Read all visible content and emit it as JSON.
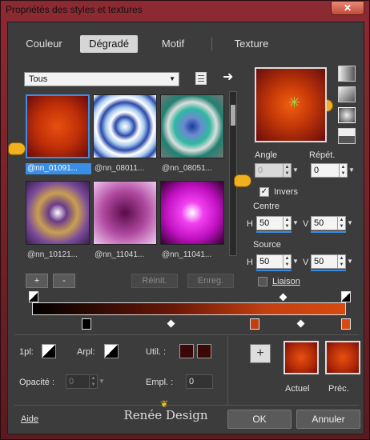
{
  "window": {
    "title": "Propriétés des styles et textures",
    "close_glyph": "✕"
  },
  "tabs": [
    {
      "label": "Couleur",
      "active": false
    },
    {
      "label": "Dégradé",
      "active": true
    },
    {
      "label": "Motif",
      "active": false
    },
    {
      "label": "Texture",
      "active": false
    }
  ],
  "preset_select": {
    "value": "Tous"
  },
  "swatches": [
    {
      "label": "@nn_01091...",
      "selected": true
    },
    {
      "label": "@nn_08011...",
      "selected": false
    },
    {
      "label": "@nn_08051...",
      "selected": false
    },
    {
      "label": "@nn_10121...",
      "selected": false
    },
    {
      "label": "@nn_11041...",
      "selected": false
    },
    {
      "label": "@nn_11041...",
      "selected": false
    }
  ],
  "buttons": {
    "add": "+",
    "remove": "-",
    "reset": "Réinit.",
    "save": "Enreg.",
    "ok": "OK",
    "cancel": "Annuler",
    "help": "Aide",
    "plus": "+"
  },
  "angle": {
    "label": "Angle",
    "value": "0"
  },
  "repeat": {
    "label": "Répét.",
    "value": "0"
  },
  "invert": {
    "label": "Invers",
    "checked": true
  },
  "center": {
    "label": "Centre",
    "h_label": "H",
    "h_value": "50",
    "v_label": "V",
    "v_value": "50"
  },
  "source": {
    "label": "Source",
    "h_label": "H",
    "h_value": "50",
    "v_label": "V",
    "v_value": "50"
  },
  "link": {
    "label": "Liaison",
    "checked": false
  },
  "bottom": {
    "first_label": "1pl:",
    "arpl_label": "Arpl:",
    "util_label": "Util. :",
    "opacity_label": "Opacité :",
    "opacity_value": "0",
    "empl_label": "Empl. :",
    "empl_value": "0",
    "current_label": "Actuel",
    "previous_label": "Préc."
  },
  "brand": "Renée Design",
  "colors": {
    "accent": "#3a8ee6",
    "window_frame": "#8c2a33",
    "panel": "#3c3c3c"
  }
}
